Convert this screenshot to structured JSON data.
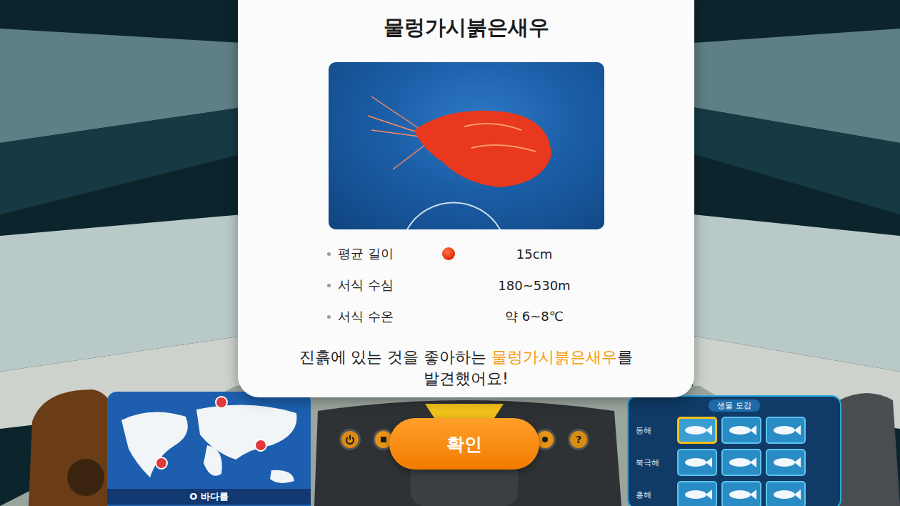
{
  "card": {
    "title": "물렁가시붉은새우"
  },
  "stats": [
    {
      "label": "평균 길이",
      "value": "15cm",
      "pointed": true
    },
    {
      "label": "서식 수심",
      "value": "180~530m",
      "pointed": false
    },
    {
      "label": "서식 수온",
      "value": "약 6~8℃",
      "pointed": false
    }
  ],
  "message": {
    "before": "진흙에 있는 것을 좋아하는 ",
    "highlight": "물렁가시붉은새우",
    "after": "를",
    "line2": "발견했어요!"
  },
  "confirm_button": "확인",
  "map_panel": {
    "caption": "O 바다를"
  },
  "console": {
    "help": "?"
  },
  "encyclopedia": {
    "title": "생물 도감",
    "rows": [
      {
        "label": "동해",
        "slots": [
          {
            "selected": true
          },
          {
            "selected": false
          },
          {
            "selected": false
          }
        ]
      },
      {
        "label": "북극해",
        "slots": [
          {
            "selected": false
          },
          {
            "selected": false
          },
          {
            "selected": false
          }
        ]
      },
      {
        "label": "홍해",
        "slots": [
          {
            "selected": false
          },
          {
            "selected": false
          },
          {
            "selected": false
          }
        ]
      }
    ]
  }
}
